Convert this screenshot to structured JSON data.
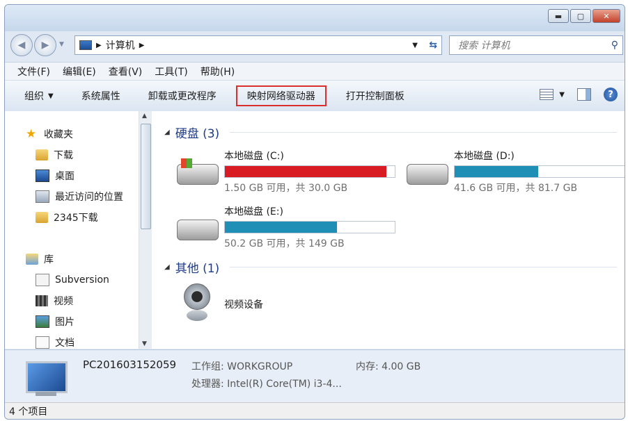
{
  "address": {
    "path_label": "计算机",
    "search_placeholder": "搜索 计算机"
  },
  "menu": [
    "文件(F)",
    "编辑(E)",
    "查看(V)",
    "工具(T)",
    "帮助(H)"
  ],
  "toolbar": {
    "organize": "组织",
    "system_props": "系统属性",
    "uninstall": "卸载或更改程序",
    "map_drive": "映射网络驱动器",
    "control_panel": "打开控制面板"
  },
  "sidebar": {
    "favorites": "收藏夹",
    "downloads": "下载",
    "desktop": "桌面",
    "recent": "最近访问的位置",
    "downloads2345": "2345下载",
    "libraries": "库",
    "subversion": "Subversion",
    "videos": "视频",
    "pictures": "图片",
    "documents": "文档"
  },
  "groups": {
    "hard_disks": "硬盘 (3)",
    "other": "其他 (1)"
  },
  "drives": [
    {
      "name": "本地磁盘 (C:)",
      "free_text": "1.50 GB 可用，共 30.0 GB",
      "used_fraction": 0.95,
      "bar_color": "#d91c24"
    },
    {
      "name": "本地磁盘 (D:)",
      "free_text": "41.6 GB 可用，共 81.7 GB",
      "used_fraction": 0.49,
      "bar_color": "#1f8fb5"
    },
    {
      "name": "本地磁盘 (E:)",
      "free_text": "50.2 GB 可用，共 149 GB",
      "used_fraction": 0.66,
      "bar_color": "#1f8fb5"
    }
  ],
  "other_devices": [
    {
      "name": "视频设备"
    }
  ],
  "details": {
    "computer_name": "PC201603152059",
    "workgroup": "工作组: WORKGROUP",
    "memory": "内存: 4.00 GB",
    "processor": "处理器: Intel(R) Core(TM) i3-4..."
  },
  "status": {
    "items": "4 个项目"
  },
  "colors": {
    "accent": "#1e3b8a",
    "highlight_border": "#d9302e"
  }
}
